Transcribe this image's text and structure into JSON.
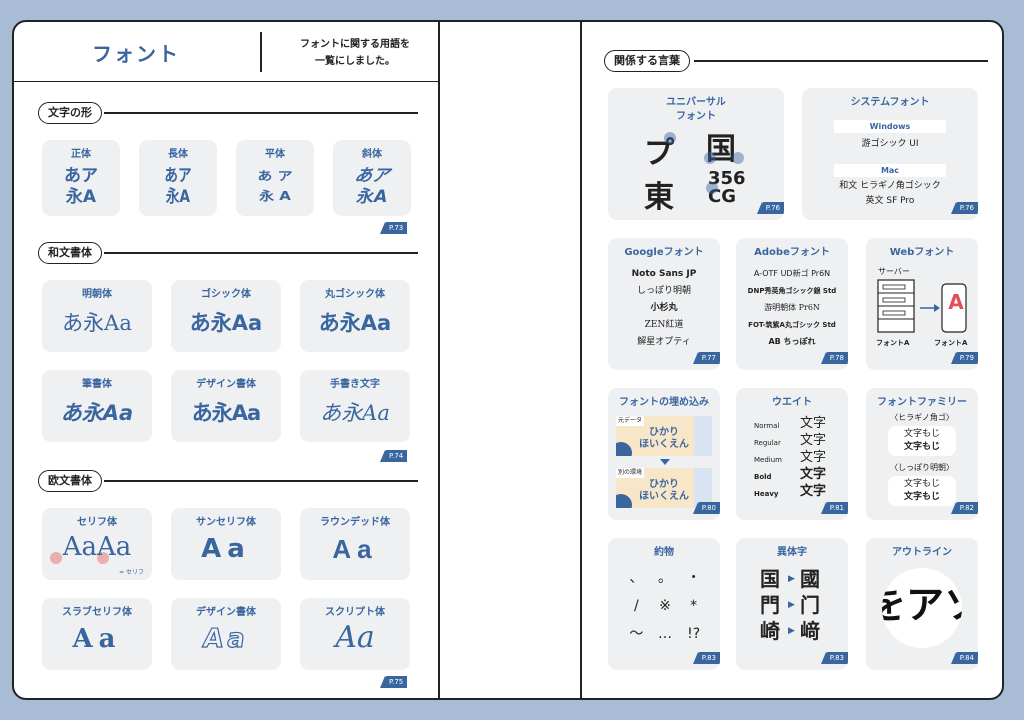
{
  "left_page": {
    "title": "フォント",
    "subtitle_line1": "フォントに関する用語を",
    "subtitle_line2": "一覧にしました。",
    "sections": [
      {
        "label": "文字の形",
        "cards": [
          {
            "title": "正体",
            "line1": "あア",
            "line2": "永A"
          },
          {
            "title": "長体",
            "line1": "あア",
            "line2": "永A"
          },
          {
            "title": "平体",
            "line1": "あ ア",
            "line2": "永 A"
          },
          {
            "title": "斜体",
            "line1": "あア",
            "line2": "永A"
          }
        ],
        "page_ref": "P.73"
      },
      {
        "label": "和文書体",
        "cards": [
          {
            "title": "明朝体",
            "sample": "あ永Aa"
          },
          {
            "title": "ゴシック体",
            "sample": "あ永Aa"
          },
          {
            "title": "丸ゴシック体",
            "sample": "あ永Aa"
          },
          {
            "title": "筆書体",
            "sample": "あ永Aa"
          },
          {
            "title": "デザイン書体",
            "sample": "あ永Aa"
          },
          {
            "title": "手書き文字",
            "sample": "あ永Aa"
          }
        ],
        "page_ref": "P.74"
      },
      {
        "label": "欧文書体",
        "cards": [
          {
            "title": "セリフ体",
            "sample": "AaAa",
            "note": "= セリフ"
          },
          {
            "title": "サンセリフ体",
            "sample": "Aa"
          },
          {
            "title": "ラウンデッド体",
            "sample": "Aa"
          },
          {
            "title": "スラブセリフ体",
            "sample": "Aa"
          },
          {
            "title": "デザイン書体",
            "sample": "Aa"
          },
          {
            "title": "スクリプト体",
            "sample": "Aa"
          }
        ],
        "page_ref": "P.75"
      }
    ]
  },
  "right_page": {
    "section_label": "関係する言葉",
    "cards": {
      "universal": {
        "title_line1": "ユニバーサル",
        "title_line2": "フォント",
        "chars": [
          "プ",
          "国",
          "東",
          "356",
          "CG"
        ],
        "page_ref": "P.76"
      },
      "system": {
        "title": "システムフォント",
        "windows_label": "Windows",
        "windows_font": "游ゴシック UI",
        "mac_label": "Mac",
        "mac_line1": "和文 ヒラギノ角ゴシック",
        "mac_line2": "英文 SF Pro",
        "page_ref": "P.76"
      },
      "google": {
        "title": "Googleフォント",
        "items": [
          "Noto Sans JP",
          "しっぽり明朝",
          "小杉丸",
          "ZEN紅道",
          "解星オプティ"
        ],
        "page_ref": "P.77"
      },
      "adobe": {
        "title": "Adobeフォント",
        "items": [
          "A-OTF UD新ゴ Pr6N",
          "DNP秀英角ゴシック銀 Std",
          "游明朝体 Pr6N",
          "FOT-筑紫A丸ゴシック Std",
          "AB ちっぽれ"
        ],
        "page_ref": "P.78"
      },
      "web": {
        "title": "Webフォント",
        "server_label": "サーバー",
        "left_caption": "フォントA",
        "right_caption": "フォントA",
        "glyph": "A",
        "page_ref": "P.79"
      },
      "embed": {
        "title": "フォントの埋め込み",
        "top_tag": "元データ",
        "bottom_tag": "別の環境",
        "text_line1": "ひかり",
        "text_line2": "ほいくえん",
        "page_ref": "P.80"
      },
      "weight": {
        "title": "ウエイト",
        "rows": [
          {
            "name": "Normal",
            "sample": "文字"
          },
          {
            "name": "Regular",
            "sample": "文字"
          },
          {
            "name": "Medium",
            "sample": "文字"
          },
          {
            "name": "Bold",
            "sample": "文字"
          },
          {
            "name": "Heavy",
            "sample": "文字"
          }
        ],
        "page_ref": "P.81"
      },
      "family": {
        "title": "フォントファミリー",
        "group1_label": "〈ヒラギノ角ゴ〉",
        "group1_line1": "文字もじ",
        "group1_line2": "文字もじ",
        "group2_label": "〈しっぽり明朝〉",
        "group2_line1": "文字もじ",
        "group2_line2": "文字もじ",
        "page_ref": "P.82"
      },
      "yakumono": {
        "title": "約物",
        "symbols": [
          "、",
          "。",
          "・",
          "/",
          "※",
          "*",
          "〜",
          "…",
          "!?"
        ],
        "page_ref": "P.83"
      },
      "itaiji": {
        "title": "異体字",
        "rows": [
          {
            "from": "国",
            "to": "國"
          },
          {
            "from": "門",
            "to": "门"
          },
          {
            "from": "崎",
            "to": "﨑"
          }
        ],
        "page_ref": "P.83"
      },
      "outline": {
        "title": "アウトライン",
        "sample": "をアソ",
        "page_ref": "P.84"
      }
    }
  },
  "colors": {
    "accent": "#3a66a0",
    "card_bg": "#eef0f2",
    "page_bg": "#a9bcd6"
  }
}
